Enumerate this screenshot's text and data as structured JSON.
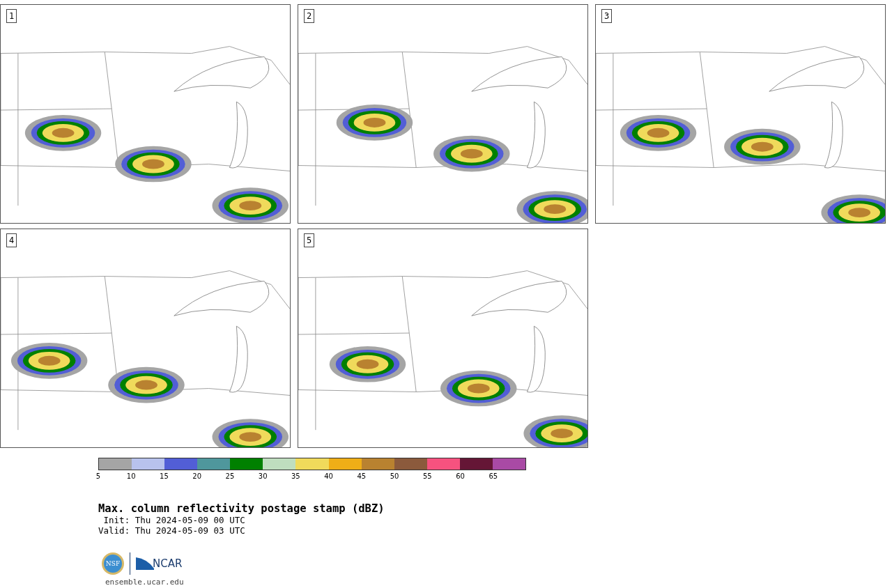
{
  "panels": [
    {
      "label": "1"
    },
    {
      "label": "2"
    },
    {
      "label": "3"
    },
    {
      "label": "4"
    },
    {
      "label": "5"
    }
  ],
  "colorbar": {
    "segments": [
      {
        "color": "#a5a5a5"
      },
      {
        "color": "#b8c2ed"
      },
      {
        "color": "#525ed6"
      },
      {
        "color": "#4f979c"
      },
      {
        "color": "#008000"
      },
      {
        "color": "#bfdebf"
      },
      {
        "color": "#f0da5b"
      },
      {
        "color": "#efae17"
      },
      {
        "color": "#b98230"
      },
      {
        "color": "#8b5a3c"
      },
      {
        "color": "#f6527f"
      },
      {
        "color": "#651636"
      },
      {
        "color": "#a94aa5"
      }
    ],
    "ticks": [
      "5",
      "10",
      "15",
      "20",
      "25",
      "30",
      "35",
      "40",
      "45",
      "50",
      "55",
      "60",
      "65"
    ]
  },
  "title": "Max. column reflectivity postage stamp (dBZ)",
  "init": " Init: Thu 2024-05-09 00 UTC",
  "valid": "Valid: Thu 2024-05-09 03 UTC",
  "logos": {
    "nsf": "NSF",
    "ncar": "NCAR"
  },
  "url": "ensemble.ucar.edu"
}
